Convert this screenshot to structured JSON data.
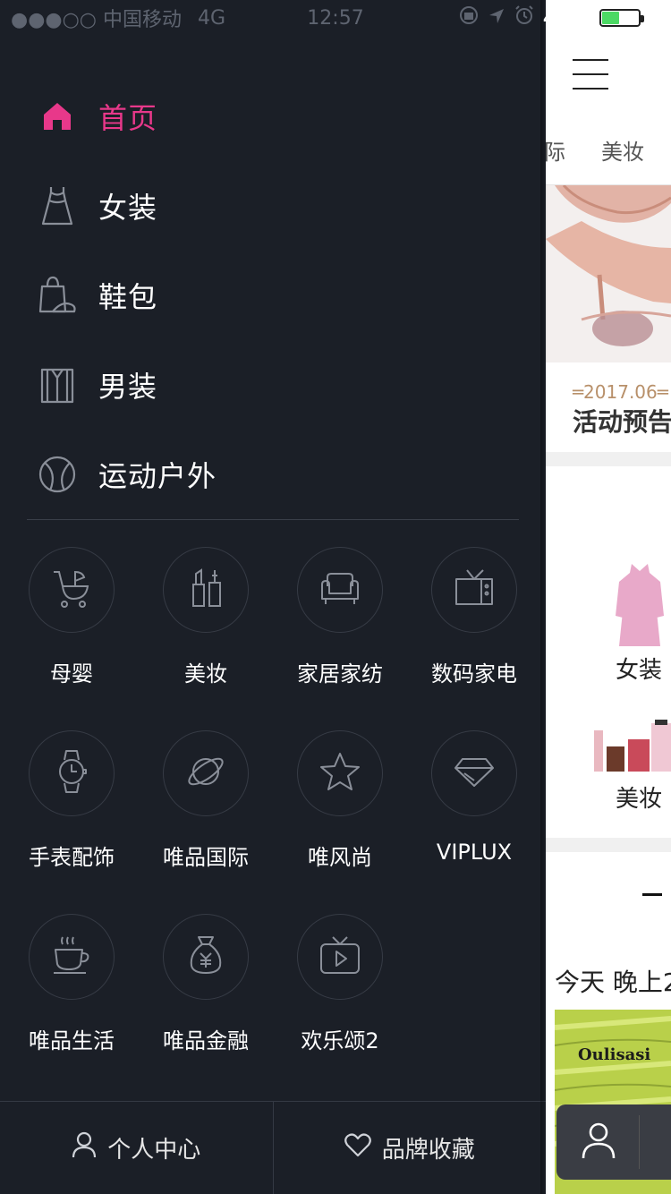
{
  "status_bar": {
    "carrier": "●●●○○ 中国移动",
    "network": "4G",
    "time": "12:57",
    "battery": "45%",
    "battery_level": 0.45
  },
  "drawer": {
    "nav": [
      {
        "label": "首页",
        "icon": "home-icon",
        "active": true
      },
      {
        "label": "女装",
        "icon": "dress-icon",
        "active": false
      },
      {
        "label": "鞋包",
        "icon": "bag-icon",
        "active": false
      },
      {
        "label": "男装",
        "icon": "shirt-icon",
        "active": false
      },
      {
        "label": "运动户外",
        "icon": "ball-icon",
        "active": false
      }
    ],
    "grid": [
      {
        "label": "母婴",
        "icon": "stroller-icon"
      },
      {
        "label": "美妆",
        "icon": "cosmetics-icon"
      },
      {
        "label": "家居家纺",
        "icon": "sofa-icon"
      },
      {
        "label": "数码家电",
        "icon": "tv-icon"
      },
      {
        "label": "手表配饰",
        "icon": "watch-icon"
      },
      {
        "label": "唯品国际",
        "icon": "planet-icon"
      },
      {
        "label": "唯风尚",
        "icon": "star-icon"
      },
      {
        "label": "VIPLUX",
        "icon": "diamond-icon"
      },
      {
        "label": "唯品生活",
        "icon": "coffee-cup-icon"
      },
      {
        "label": "唯品金融",
        "icon": "money-bag-icon"
      },
      {
        "label": "欢乐颂2",
        "icon": "tv-play-icon"
      }
    ],
    "bottom": {
      "profile_label": "个人中心",
      "favorites_label": "品牌收藏"
    }
  },
  "peek": {
    "tabs": [
      "际",
      "美妆"
    ],
    "date": "═2017.06═",
    "notice_title": "活动预告",
    "categories": [
      "女装",
      "美妆"
    ],
    "today_label": "今天 晚上2",
    "product_brand": "Oulisasi"
  },
  "colors": {
    "drawer_bg": "#1b1f27",
    "accent": "#e8388a",
    "icon_stroke": "#8a8f99"
  }
}
